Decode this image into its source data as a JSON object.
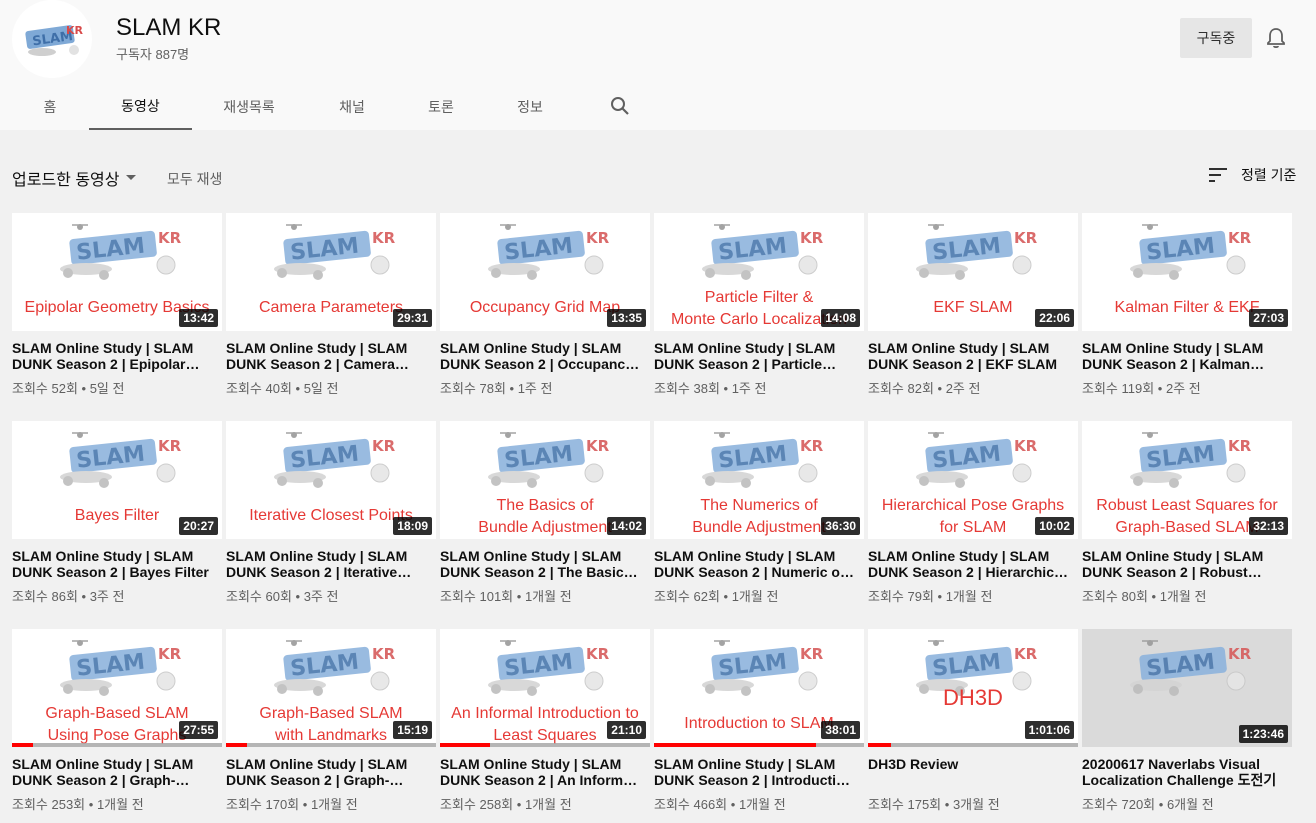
{
  "channel": {
    "name": "SLAM KR",
    "subscribers": "구독자 887명",
    "subscribe_label": "구독중",
    "avatar_logo_text": "SLAM KR"
  },
  "tabs": [
    {
      "label": "홈"
    },
    {
      "label": "동영상"
    },
    {
      "label": "재생목록"
    },
    {
      "label": "채널"
    },
    {
      "label": "토론"
    },
    {
      "label": "정보"
    }
  ],
  "toolbar": {
    "section_label": "업로드한 동영상",
    "play_all_label": "모두 재생",
    "sort_label": "정렬 기준"
  },
  "colors": {
    "accent_red": "#ff0000",
    "thumb_text_red": "#e53935"
  },
  "videos": [
    {
      "thumb_lines": [
        "Epipolar Geometry Basics"
      ],
      "duration": "13:42",
      "title": "SLAM Online Study | SLAM DUNK Season 2 | Epipolar…",
      "views": "조회수 52회",
      "age": "5일 전"
    },
    {
      "thumb_lines": [
        "Camera Parameters"
      ],
      "duration": "29:31",
      "title": "SLAM Online Study | SLAM DUNK Season 2 | Camera…",
      "views": "조회수 40회",
      "age": "5일 전"
    },
    {
      "thumb_lines": [
        "Occupancy Grid Map"
      ],
      "duration": "13:35",
      "title": "SLAM Online Study | SLAM DUNK Season 2 | Occupanc…",
      "views": "조회수 78회",
      "age": "1주 전"
    },
    {
      "thumb_lines": [
        "Particle Filter &",
        "Monte Carlo Localization"
      ],
      "duration": "14:08",
      "title": "SLAM Online Study | SLAM DUNK Season 2 | Particle…",
      "views": "조회수 38회",
      "age": "1주 전"
    },
    {
      "thumb_lines": [
        "EKF SLAM"
      ],
      "duration": "22:06",
      "title": "SLAM Online Study | SLAM DUNK Season 2 | EKF SLAM",
      "views": "조회수 82회",
      "age": "2주 전"
    },
    {
      "thumb_lines": [
        "Kalman Filter & EKF"
      ],
      "duration": "27:03",
      "title": "SLAM Online Study | SLAM DUNK Season 2 | Kalman…",
      "views": "조회수 119회",
      "age": "2주 전"
    },
    {
      "thumb_lines": [
        "Bayes Filter"
      ],
      "duration": "20:27",
      "title": "SLAM Online Study | SLAM DUNK Season 2 | Bayes Filter",
      "views": "조회수 86회",
      "age": "3주 전"
    },
    {
      "thumb_lines": [
        "Iterative Closest Points"
      ],
      "duration": "18:09",
      "title": "SLAM Online Study | SLAM DUNK Season 2 | Iterative…",
      "views": "조회수 60회",
      "age": "3주 전"
    },
    {
      "thumb_lines": [
        "The Basics of",
        "Bundle Adjustment"
      ],
      "duration": "14:02",
      "title": "SLAM Online Study | SLAM DUNK Season 2 | The Basic…",
      "views": "조회수 101회",
      "age": "1개월 전"
    },
    {
      "thumb_lines": [
        "The Numerics of",
        "Bundle Adjustment"
      ],
      "duration": "36:30",
      "title": "SLAM Online Study | SLAM DUNK Season 2 | Numeric o…",
      "views": "조회수 62회",
      "age": "1개월 전"
    },
    {
      "thumb_lines": [
        "Hierarchical Pose Graphs",
        "for SLAM"
      ],
      "duration": "10:02",
      "title": "SLAM Online Study | SLAM DUNK Season 2 | Hierarchic…",
      "views": "조회수 79회",
      "age": "1개월 전"
    },
    {
      "thumb_lines": [
        "Robust Least Squares for",
        "Graph-Based SLAM"
      ],
      "duration": "32:13",
      "title": "SLAM Online Study | SLAM DUNK Season 2 | Robust…",
      "views": "조회수 80회",
      "age": "1개월 전"
    },
    {
      "thumb_lines": [
        "Graph-Based SLAM",
        "Using Pose Graphs"
      ],
      "duration": "27:55",
      "title": "SLAM Online Study | SLAM DUNK Season 2 | Graph-…",
      "views": "조회수 253회",
      "age": "1개월 전",
      "progress": 0.1
    },
    {
      "thumb_lines": [
        "Graph-Based SLAM",
        "with Landmarks"
      ],
      "duration": "15:19",
      "title": "SLAM Online Study | SLAM DUNK Season 2 | Graph-…",
      "views": "조회수 170회",
      "age": "1개월 전",
      "progress": 0.1
    },
    {
      "thumb_lines": [
        "An Informal Introduction to",
        "Least Squares"
      ],
      "duration": "21:10",
      "title": "SLAM Online Study | SLAM DUNK Season 2 | An Inform…",
      "views": "조회수 258회",
      "age": "1개월 전",
      "progress": 0.24
    },
    {
      "thumb_lines": [
        "Introduction to SLAM"
      ],
      "duration": "38:01",
      "title": "SLAM Online Study | SLAM DUNK Season 2 | Introducti…",
      "views": "조회수 466회",
      "age": "1개월 전",
      "progress": 0.77
    },
    {
      "thumb_lines": [],
      "thumb_overlay": "DH3D",
      "duration": "1:01:06",
      "title": "DH3D Review",
      "views": "조회수 175회",
      "age": "3개월 전",
      "progress": 0.11
    },
    {
      "thumb_lines": [],
      "dark": true,
      "duration": "1:23:46",
      "title": "20200617 Naverlabs Visual Localization Challenge 도전기",
      "views": "조회수 720회",
      "age": "6개월 전"
    }
  ]
}
